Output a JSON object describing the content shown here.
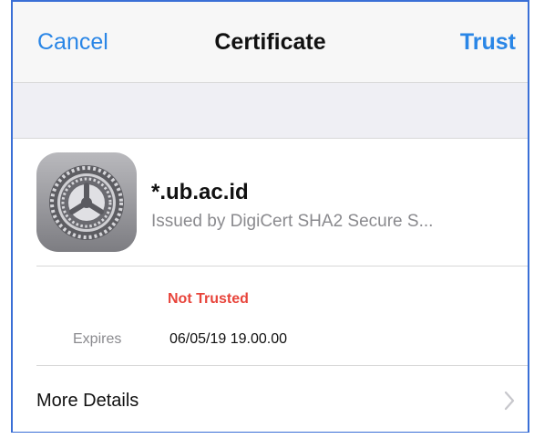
{
  "navbar": {
    "cancel_label": "Cancel",
    "title": "Certificate",
    "trust_label": "Trust"
  },
  "certificate": {
    "icon": "settings-gear-icon",
    "name": "*.ub.ac.id",
    "issuer": "Issued by DigiCert SHA2 Secure S...",
    "status": "Not Trusted",
    "expires_label": "Expires",
    "expires_value": "06/05/19 19.00.00"
  },
  "more_details": {
    "label": "More Details",
    "icon": "chevron-right-icon"
  },
  "colors": {
    "accent": "#2a86e6",
    "status_untrusted": "#e8453c",
    "secondary_text": "#8a8a8e",
    "frame_border": "#3a6fd6"
  }
}
